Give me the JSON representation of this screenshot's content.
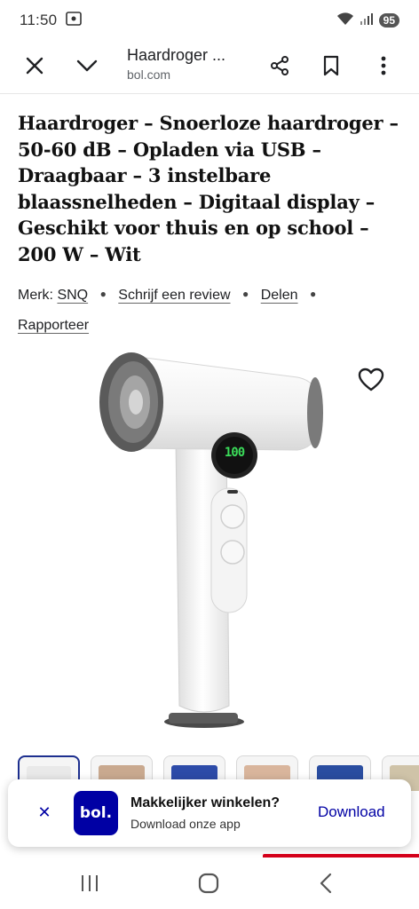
{
  "status_bar": {
    "time": "11:50",
    "battery": "95"
  },
  "toolbar": {
    "title": "Haardroger ...",
    "domain": "bol.com"
  },
  "product": {
    "title": "Haardroger – Snoerloze haardroger – 50-60 dB – Opladen via USB – Draagbaar – 3 instelbare blaassnelheden – Digitaal display – Geschikt voor thuis en op school – 200 W – Wit",
    "brand_label": "Merk:",
    "brand": "SNQ",
    "review_link": "Schrijf een review",
    "share_link": "Delen",
    "report_link": "Rapporteer",
    "display_readout": "100"
  },
  "app_banner": {
    "logo_text": "bol.",
    "title": "Makkelijker winkelen?",
    "subtitle": "Download onze app",
    "download_label": "Download"
  },
  "colors": {
    "brand_blue": "#0000a4",
    "accent_red": "#d4001a",
    "display_green": "#3bdc5a"
  }
}
